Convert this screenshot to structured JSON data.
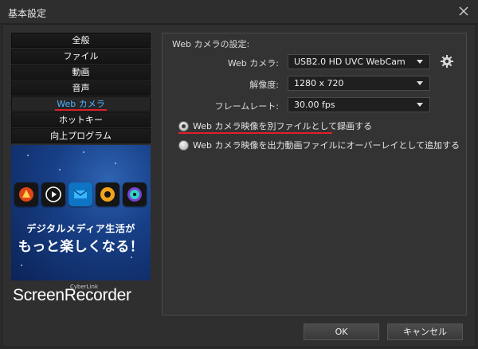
{
  "window": {
    "title": "基本設定"
  },
  "nav": {
    "items": [
      {
        "label": "全般"
      },
      {
        "label": "ファイル"
      },
      {
        "label": "動画"
      },
      {
        "label": "音声"
      },
      {
        "label": "Web カメラ",
        "active": true
      },
      {
        "label": "ホットキー"
      },
      {
        "label": "向上プログラム"
      }
    ]
  },
  "promo": {
    "line1": "デジタルメディア生活が",
    "line2": "もっと楽しくなる！",
    "icons": [
      "power-director-icon",
      "play-icon",
      "mail-icon",
      "aperture-icon",
      "disc-icon"
    ]
  },
  "brand": {
    "small": "CyberLink",
    "name": "ScreenRecorder"
  },
  "settings": {
    "section_title": "Web カメラの設定:",
    "webcam_label": "Web カメラ:",
    "webcam_value": "USB2.0 HD UVC WebCam",
    "resolution_label": "解像度:",
    "resolution_value": "1280 x 720",
    "framerate_label": "フレームレート:",
    "framerate_value": "30.00 fps",
    "option1": "Web カメラ映像を別ファイルとして録画する",
    "option2": "Web カメラ映像を出力動画ファイルにオーバーレイとして追加する",
    "selected_option": 1
  },
  "buttons": {
    "ok": "OK",
    "cancel": "キャンセル"
  },
  "colors": {
    "accent_blue": "#4fb2ff",
    "highlight_red": "#e0202a"
  }
}
